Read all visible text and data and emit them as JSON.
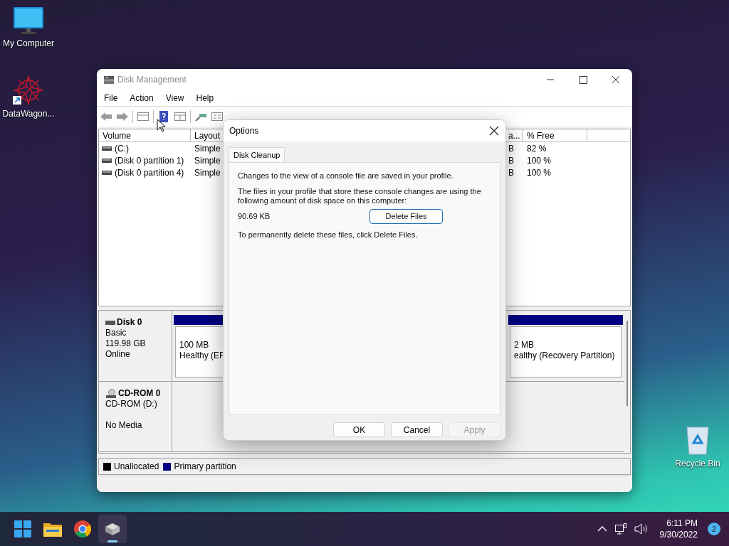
{
  "desktop_icons": [
    {
      "kind": "monitor",
      "label": "My Computer"
    },
    {
      "kind": "shortcut",
      "label": "DataWagon..."
    },
    {
      "kind": "recycle",
      "label": "Recycle Bin"
    }
  ],
  "window": {
    "title": "Disk Management",
    "menu": [
      "File",
      "Action",
      "View",
      "Help"
    ],
    "volume_table": {
      "columns": [
        "Volume",
        "Layout",
        "a...",
        "% Free"
      ],
      "rows": [
        {
          "volume": "(C:)",
          "layout": "Simple",
          "column_3": "B",
          "free": "82 %"
        },
        {
          "volume": "(Disk 0 partition 1)",
          "layout": "Simple",
          "column_3": "B",
          "free": "100 %"
        },
        {
          "volume": "(Disk 0 partition 4)",
          "layout": "Simple",
          "column_3": "B",
          "free": "100 %"
        }
      ]
    },
    "disks": [
      {
        "kind": "disk",
        "name": "Disk 0",
        "type_line": "Basic",
        "size_line": "119.98 GB",
        "status_line": "Online",
        "partitions": [
          {
            "size": "100 MB",
            "status": "Healthy (EF"
          },
          {
            "size": "2 MB",
            "status": "ealthy (Recovery Partition)"
          }
        ]
      },
      {
        "kind": "cdrom",
        "name": "CD-ROM 0",
        "type_line": "CD-ROM (D:)",
        "status_line": "No Media"
      }
    ],
    "legend": [
      {
        "label": "Unallocated",
        "color": "#000000"
      },
      {
        "label": "Primary partition",
        "color": "#000080"
      }
    ]
  },
  "dialog": {
    "title": "Options",
    "tabs": [
      {
        "label": "Disk Cleanup",
        "selected": true
      }
    ],
    "text_1": "Changes to the view of a console file are saved in your profile.",
    "text_2": "The files in your profile that store these console changes are using the following amount of disk space on this computer:",
    "size": "90.69 KB",
    "delete_button": "Delete Files",
    "text_3": "To permanently delete these files, click Delete Files.",
    "buttons": [
      {
        "label": "OK",
        "disabled": false
      },
      {
        "label": "Cancel",
        "disabled": false
      },
      {
        "label": "Apply",
        "disabled": true
      }
    ]
  },
  "taskbar": {
    "apps": [
      {
        "kind": "start",
        "active": false
      },
      {
        "kind": "folder",
        "active": false
      },
      {
        "kind": "browser",
        "active": false
      },
      {
        "kind": "disk",
        "active": true
      }
    ],
    "time": "6:11 PM",
    "date": "9/30/2022",
    "notifications": "2"
  }
}
